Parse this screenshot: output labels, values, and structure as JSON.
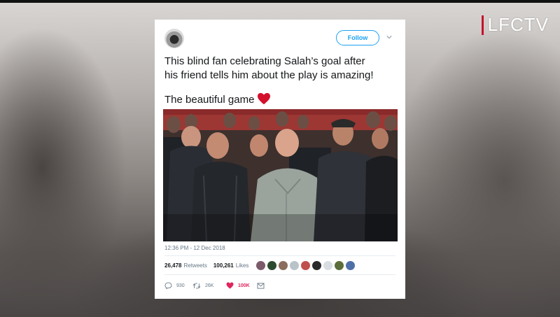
{
  "watermark": {
    "text": "LFCTV"
  },
  "tweet": {
    "follow_label": "Follow",
    "text_line1": "This blind fan celebrating Salah’s goal  after",
    "text_line2": "his friend tells him about the play is amazing!",
    "text_line3": "The beautiful game",
    "timestamp": "12:36 PM - 12 Dec 2018",
    "retweets_count": "26,478",
    "retweets_label": "Retweets",
    "likes_count": "100,261",
    "likes_label": "Likes",
    "reply_count": "930",
    "retweet_action_count": "26K",
    "like_action_count": "100K"
  },
  "colors": {
    "accent": "#1da1f2",
    "like": "#e0245e",
    "heart_emoji": "#d4102c",
    "brand": "#c8102e"
  },
  "icons": [
    "chevron-down-icon",
    "heart-icon",
    "reply-icon",
    "retweet-icon",
    "like-icon",
    "message-icon"
  ]
}
